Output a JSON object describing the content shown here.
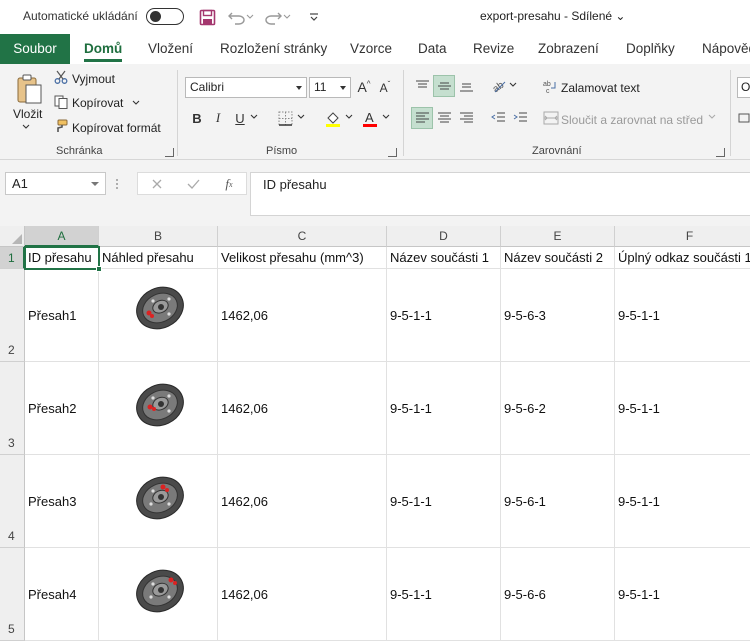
{
  "titlebar": {
    "autosave_label": "Automatické ukládání",
    "doc_title": "export-presahu  -  Sdílené",
    "doc_title_chevron": "⌄"
  },
  "tabs": [
    {
      "label": "Soubor"
    },
    {
      "label": "Domů"
    },
    {
      "label": "Vložení"
    },
    {
      "label": "Rozložení stránky"
    },
    {
      "label": "Vzorce"
    },
    {
      "label": "Data"
    },
    {
      "label": "Revize"
    },
    {
      "label": "Zobrazení"
    },
    {
      "label": "Doplňky"
    },
    {
      "label": "Nápověda"
    }
  ],
  "ribbon": {
    "clipboard": {
      "paste": "Vložit",
      "cut": "Vyjmout",
      "copy": "Kopírovat",
      "format_painter": "Kopírovat formát",
      "group": "Schránka"
    },
    "font": {
      "font_name": "Calibri",
      "font_size": "11",
      "bold": "B",
      "italic": "I",
      "underline": "U",
      "group": "Písmo",
      "fill_color": "#ffff00",
      "font_color": "#ff0000"
    },
    "alignment": {
      "wrap_text": "Zalamovat text",
      "merge_center": "Sloučit a zarovnat na střed",
      "group": "Zarovnání"
    },
    "number_partial": "O"
  },
  "formula_bar": {
    "name_box": "A1",
    "formula": "ID přesahu"
  },
  "sheet": {
    "columns": [
      "A",
      "B",
      "C",
      "D",
      "E",
      "F"
    ],
    "rows": [
      "1",
      "2",
      "3",
      "4",
      "5"
    ],
    "headers": [
      "ID přesahu",
      "Náhled přesahu",
      "Velikost přesahu (mm^3)",
      "Název součásti 1",
      "Název součásti 2",
      "Úplný odkaz součásti 1"
    ],
    "data": [
      {
        "id": "Přesah1",
        "size": "1462,06",
        "part1": "9-5-1-1",
        "part2": "9-5-6-3",
        "ref1": "9-5-1-1"
      },
      {
        "id": "Přesah2",
        "size": "1462,06",
        "part1": "9-5-1-1",
        "part2": "9-5-6-2",
        "ref1": "9-5-1-1"
      },
      {
        "id": "Přesah3",
        "size": "1462,06",
        "part1": "9-5-1-1",
        "part2": "9-5-6-1",
        "ref1": "9-5-1-1"
      },
      {
        "id": "Přesah4",
        "size": "1462,06",
        "part1": "9-5-1-1",
        "part2": "9-5-6-6",
        "ref1": "9-5-1-1"
      }
    ]
  },
  "colors": {
    "accent": "#217346",
    "ribbon_bg": "#f3f3f3"
  }
}
